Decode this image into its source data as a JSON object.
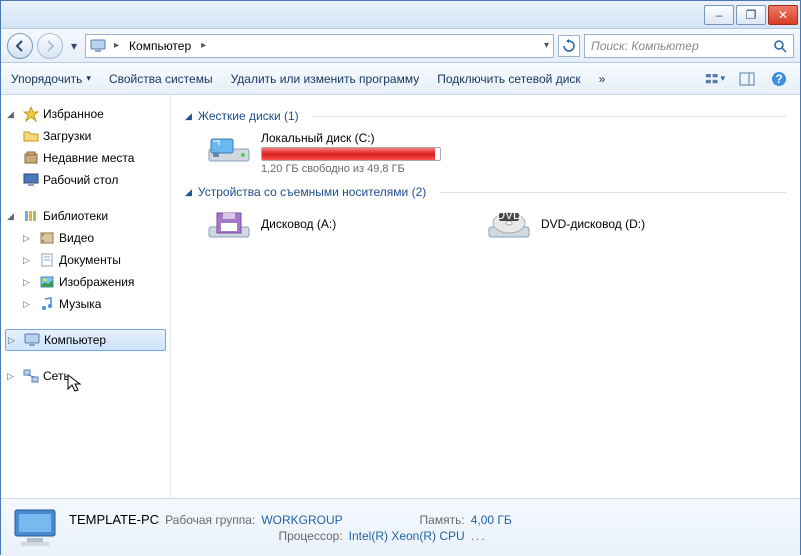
{
  "titlebar": {
    "min": "–",
    "max": "❐",
    "close": "✕"
  },
  "navbar": {
    "breadcrumb": [
      "Компьютер"
    ],
    "search_placeholder": "Поиск: Компьютер"
  },
  "toolbar": {
    "organize": "Упорядочить",
    "properties": "Свойства системы",
    "uninstall": "Удалить или изменить программу",
    "mapdrive": "Подключить сетевой диск",
    "overflow": "»"
  },
  "sidebar": {
    "favorites": {
      "label": "Избранное",
      "items": [
        "Загрузки",
        "Недавние места",
        "Рабочий стол"
      ]
    },
    "libraries": {
      "label": "Библиотеки",
      "items": [
        "Видео",
        "Документы",
        "Изображения",
        "Музыка"
      ]
    },
    "computer": {
      "label": "Компьютер"
    },
    "network": {
      "label": "Сеть"
    }
  },
  "content": {
    "group_hdd": {
      "title": "Жесткие диски (1)",
      "drives": [
        {
          "name": "Локальный диск (C:)",
          "free_text": "1,20 ГБ свободно из 49,8 ГБ",
          "fill_percent": 97
        }
      ]
    },
    "group_removable": {
      "title": "Устройства со съемными носителями (2)",
      "drives": [
        {
          "name": "Дисковод (A:)"
        },
        {
          "name": "DVD-дисковод (D:)"
        }
      ]
    }
  },
  "details": {
    "name": "TEMPLATE-PC",
    "workgroup_label": "Рабочая группа:",
    "workgroup_value": "WORKGROUP",
    "memory_label": "Память:",
    "memory_value": "4,00 ГБ",
    "cpu_label": "Процессор:",
    "cpu_value": "Intel(R) Xeon(R) CPU",
    "more": "..."
  }
}
